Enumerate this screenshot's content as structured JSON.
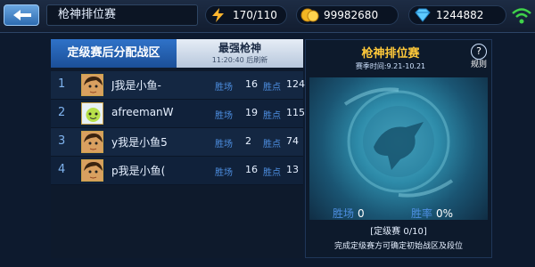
{
  "header": {
    "title": "枪神排位赛",
    "energy": "170/110",
    "gold": "99982680",
    "diamonds": "1244882"
  },
  "tabs": [
    {
      "label": "定级赛后分配战区"
    },
    {
      "label": "最强枪神",
      "sub": "11:20:40 后刷新"
    }
  ],
  "leaderboard": {
    "wins_label": "胜场",
    "points_label": "胜点",
    "rows": [
      {
        "rank": "1",
        "name": "J我是小鱼-",
        "wins": "16",
        "points": "124"
      },
      {
        "rank": "2",
        "name": "afreemanW",
        "wins": "19",
        "points": "115"
      },
      {
        "rank": "3",
        "name": "y我是小鱼5",
        "wins": "2",
        "points": "74"
      },
      {
        "rank": "4",
        "name": "p我是小鱼(",
        "wins": "16",
        "points": "13"
      }
    ]
  },
  "season_panel": {
    "title": "枪神排位赛",
    "season": "赛季时间:9.21-10.21",
    "rules": "规则",
    "wins_label": "胜场",
    "wins_value": "0",
    "winrate_label": "胜率",
    "winrate_value": "0%",
    "placement": "[定级赛  0/10]",
    "hint": "完成定级赛方可确定初始战区及段位"
  },
  "colors": {
    "accent": "#2f72c8",
    "gold_title": "#ffc93a",
    "label_blue": "#4d8ee0"
  },
  "icons": [
    "back-arrow-icon",
    "energy-icon",
    "gold-coin-icon",
    "diamond-icon",
    "wifi-icon",
    "help-icon",
    "emblem-icon"
  ]
}
